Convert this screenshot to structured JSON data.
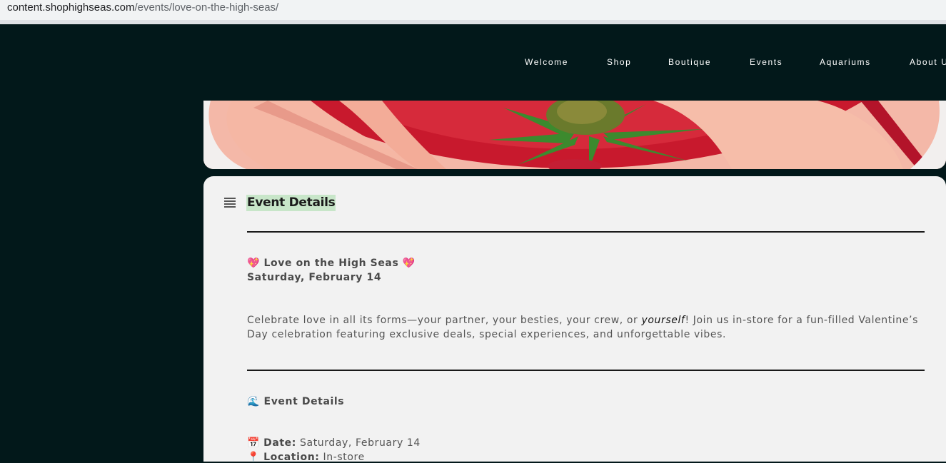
{
  "browser": {
    "url_host": "content.shophighseas.com",
    "url_path": "/events/love-on-the-high-seas/"
  },
  "nav": {
    "items": [
      "Welcome",
      "Shop",
      "Boutique",
      "Events",
      "Aquariums",
      "About U"
    ]
  },
  "card": {
    "title": "Event Details",
    "event_name": "Love on the High Seas",
    "event_emoji": "💖",
    "event_date_line": "Saturday, February 14",
    "desc_before": "Celebrate love in all its forms—your partner, your besties, your crew, or ",
    "desc_em": "yourself",
    "desc_after": "! Join us in-store for a fun-filled Valentine’s Day celebration featuring exclusive deals, special experiences, and unforgettable vibes.",
    "section_emoji": "🌊",
    "section_title": "Event Details",
    "date_emoji": "📅",
    "date_label": "Date:",
    "date_value": "Saturday, February 14",
    "location_emoji": "📍",
    "location_label": "Location:",
    "location_value": "In-store"
  },
  "colors": {
    "page_bg": "#02181a",
    "card_bg": "#f2f2f2",
    "title_highlight": "#c8e6c9"
  }
}
